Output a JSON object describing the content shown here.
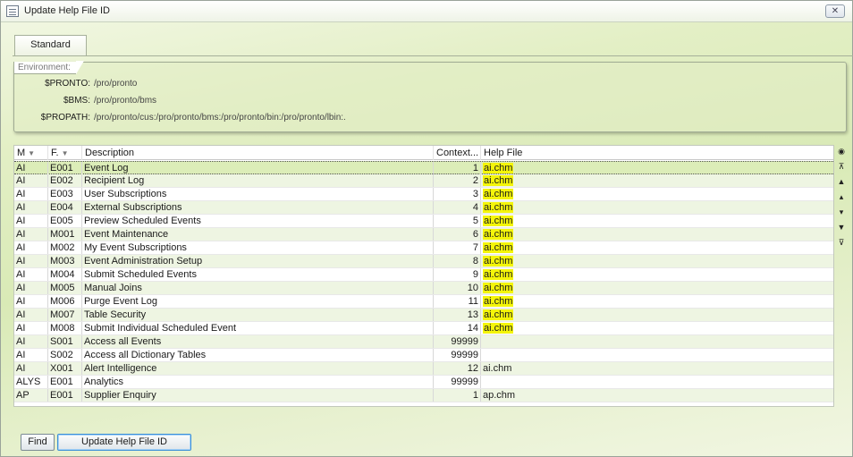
{
  "window": {
    "title": "Update Help File ID",
    "close_label": "✕"
  },
  "tabs": [
    {
      "label": "Standard"
    }
  ],
  "environment": {
    "legend": "Environment:",
    "vars": [
      {
        "key": "$PRONTO:",
        "value": "/pro/pronto"
      },
      {
        "key": "$BMS:",
        "value": "/pro/pronto/bms"
      },
      {
        "key": "$PROPATH:",
        "value": "/pro/pronto/cus:/pro/pronto/bms:/pro/pronto/bin:/pro/pronto/lbin:."
      }
    ]
  },
  "grid": {
    "columns": [
      "M",
      "F.",
      "Description",
      "Context...",
      "Help File"
    ],
    "rows": [
      {
        "m": "AI",
        "f": "E001",
        "desc": "Event Log",
        "ctx": "1",
        "help": "ai.chm",
        "help_highlight": true,
        "selected": true
      },
      {
        "m": "AI",
        "f": "E002",
        "desc": "Recipient Log",
        "ctx": "2",
        "help": "ai.chm",
        "help_highlight": true
      },
      {
        "m": "AI",
        "f": "E003",
        "desc": "User Subscriptions",
        "ctx": "3",
        "help": "ai.chm",
        "help_highlight": true
      },
      {
        "m": "AI",
        "f": "E004",
        "desc": "External Subscriptions",
        "ctx": "4",
        "help": "ai.chm",
        "help_highlight": true
      },
      {
        "m": "AI",
        "f": "E005",
        "desc": "Preview Scheduled Events",
        "ctx": "5",
        "help": "ai.chm",
        "help_highlight": true
      },
      {
        "m": "AI",
        "f": "M001",
        "desc": "Event Maintenance",
        "ctx": "6",
        "help": "ai.chm",
        "help_highlight": true
      },
      {
        "m": "AI",
        "f": "M002",
        "desc": "My Event Subscriptions",
        "ctx": "7",
        "help": "ai.chm",
        "help_highlight": true
      },
      {
        "m": "AI",
        "f": "M003",
        "desc": "Event Administration Setup",
        "ctx": "8",
        "help": "ai.chm",
        "help_highlight": true
      },
      {
        "m": "AI",
        "f": "M004",
        "desc": "Submit Scheduled Events",
        "ctx": "9",
        "help": "ai.chm",
        "help_highlight": true
      },
      {
        "m": "AI",
        "f": "M005",
        "desc": "Manual Joins",
        "ctx": "10",
        "help": "ai.chm",
        "help_highlight": true
      },
      {
        "m": "AI",
        "f": "M006",
        "desc": "Purge Event Log",
        "ctx": "11",
        "help": "ai.chm",
        "help_highlight": true
      },
      {
        "m": "AI",
        "f": "M007",
        "desc": "Table Security",
        "ctx": "13",
        "help": "ai.chm",
        "help_highlight": true
      },
      {
        "m": "AI",
        "f": "M008",
        "desc": "Submit Individual Scheduled Event",
        "ctx": "14",
        "help": "ai.chm",
        "help_highlight": true
      },
      {
        "m": "AI",
        "f": "S001",
        "desc": "Access all Events",
        "ctx": "99999",
        "help": ""
      },
      {
        "m": "AI",
        "f": "S002",
        "desc": "Access all Dictionary Tables",
        "ctx": "99999",
        "help": ""
      },
      {
        "m": "AI",
        "f": "X001",
        "desc": "Alert Intelligence",
        "ctx": "12",
        "help": "ai.chm"
      },
      {
        "m": "ALYS",
        "f": "E001",
        "desc": "Analytics",
        "ctx": "99999",
        "help": ""
      },
      {
        "m": "AP",
        "f": "E001",
        "desc": "Supplier Enquiry",
        "ctx": "1",
        "help": "ap.chm"
      }
    ]
  },
  "scroll_buttons": [
    "binoculars-icon",
    "scroll-top-icon",
    "page-up-icon",
    "line-up-icon",
    "line-down-icon",
    "page-down-icon",
    "scroll-bottom-icon"
  ],
  "buttons": {
    "find": "Find",
    "update": "Update Help File ID"
  },
  "colors": {
    "selected_row": "#dcedb8",
    "highlight": "#f4f50a",
    "accent_button": "#3c8fd8"
  }
}
